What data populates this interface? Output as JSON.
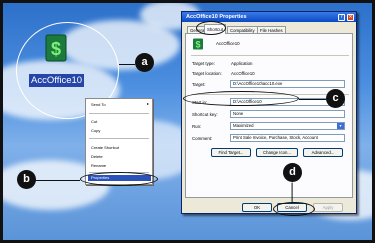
{
  "desktop": {
    "icon_name": "excel-icon",
    "label": "AccOffice10"
  },
  "callouts": {
    "a": "a",
    "b": "b",
    "c": "c",
    "d": "d"
  },
  "context_menu": {
    "items": [
      {
        "label": "Send To",
        "has_submenu": true
      },
      {
        "label": "Cut"
      },
      {
        "label": "Copy"
      },
      {
        "label": "Create Shortcut"
      },
      {
        "label": "Delete"
      },
      {
        "label": "Rename"
      },
      {
        "label": "Properties",
        "selected": true
      }
    ],
    "submenu_arrow": "▸"
  },
  "dialog": {
    "title": "AccOffice10 Properties",
    "help_glyph": "?",
    "close_glyph": "×",
    "tabs": [
      "General",
      "Shortcut",
      "Compatibility",
      "File Hashes"
    ],
    "active_tab": "Shortcut",
    "app_name": "AccOffice10",
    "fields": {
      "target_type_label": "Target type:",
      "target_type": "Application",
      "target_location_label": "Target location:",
      "target_location": "AccOffice10",
      "target_label": "Target:",
      "target": "D:\\AccOffice10\\acc10.exe",
      "start_in_label": "Start in:",
      "start_in": "D:\\AccOffice10",
      "shortcut_key_label": "Shortcut key:",
      "shortcut_key": "None",
      "run_label": "Run:",
      "run": "Maximized",
      "comment_label": "Comment:",
      "comment": "Print Sale Invoice, Purchase, Stock, Account"
    },
    "buttons": {
      "find_target": "Find Target...",
      "change_icon": "Change Icon...",
      "advanced": "Advanced...",
      "ok": "OK",
      "cancel": "Cancel",
      "apply": "Apply"
    }
  },
  "colors": {
    "titlebar": "#0a49c4",
    "selection": "#2a52b8",
    "dialog_bg": "#ece9d8"
  }
}
